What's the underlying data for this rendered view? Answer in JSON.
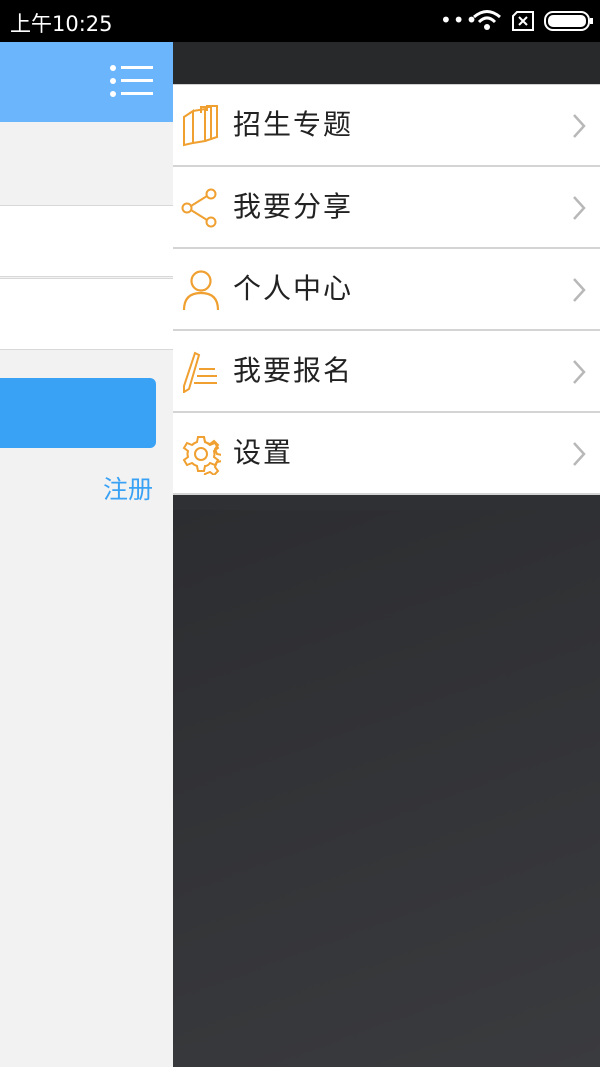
{
  "status_bar": {
    "time": "上午10:25",
    "dots": "•••"
  },
  "main": {
    "register_label": "注册"
  },
  "drawer": {
    "items": [
      {
        "label": "招生专题",
        "icon": "books-icon"
      },
      {
        "label": "我要分享",
        "icon": "share-icon"
      },
      {
        "label": "个人中心",
        "icon": "person-icon"
      },
      {
        "label": "我要报名",
        "icon": "pen-icon"
      },
      {
        "label": "设置",
        "icon": "gear-icon"
      }
    ]
  },
  "colors": {
    "header_blue": "#6ab5fb",
    "button_blue": "#3aa2f5",
    "icon_orange": "#f0a030"
  }
}
